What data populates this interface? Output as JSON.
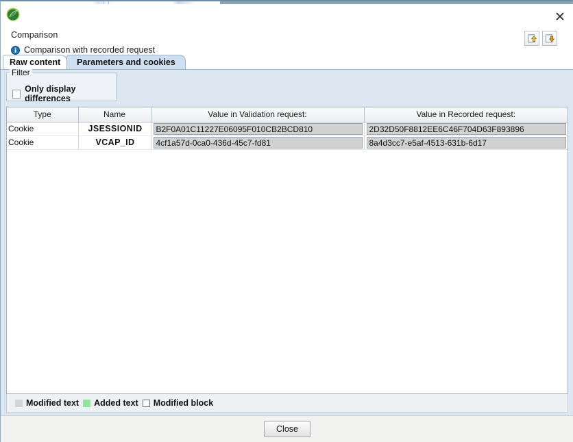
{
  "window": {
    "logo_icon": "green-leaf-logo",
    "close_icon": "close-x-icon"
  },
  "header": {
    "title": "Comparison",
    "info_icon": "info-icon",
    "subtitle": "Comparison with recorded request",
    "buttons": [
      {
        "name": "export-up-icon",
        "label": ""
      },
      {
        "name": "import-down-icon",
        "label": ""
      }
    ]
  },
  "tabs": [
    {
      "label": "Raw content",
      "active": false
    },
    {
      "label": "Parameters and cookies",
      "active": true
    }
  ],
  "filter": {
    "legend": "Filter",
    "checkbox_label": "Only display differences",
    "checked": false
  },
  "table": {
    "columns": [
      "Type",
      "Name",
      "Value in Validation request:",
      "Value in Recorded request:"
    ],
    "rows": [
      {
        "type": "Cookie",
        "name": "JSESSIONID",
        "validation_value": "B2F0A01C11227E06095F010CB2BCD810",
        "recorded_value": "2D32D50F8812EE6C46F704D63F893896"
      },
      {
        "type": "Cookie",
        "name": "VCAP_ID",
        "validation_value": "4cf1a57d-0ca0-436d-45c7-fd81",
        "recorded_value": "8a4d3cc7-e5af-4513-631b-6d17"
      }
    ]
  },
  "legend": {
    "items": [
      {
        "label": "Modified text",
        "color": "#d4d4d4",
        "swatch": "sw-mod"
      },
      {
        "label": "Added text",
        "color": "#8fe59a",
        "swatch": "sw-add"
      },
      {
        "label": "Modified block",
        "color": "#ffffff",
        "swatch": "sw-blk"
      }
    ]
  },
  "footer": {
    "close_label": "Close"
  }
}
